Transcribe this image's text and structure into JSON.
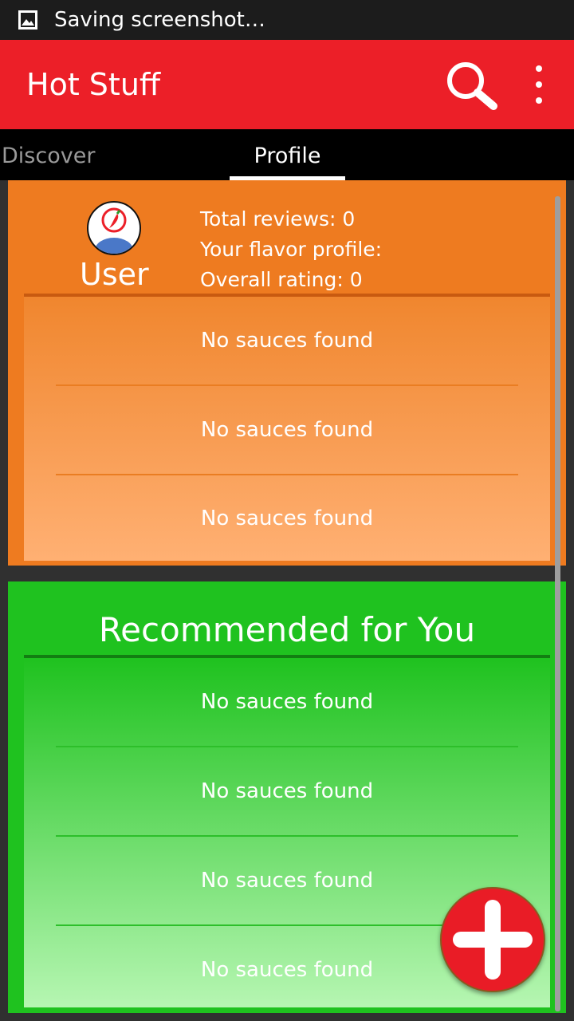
{
  "status_bar": {
    "text": "Saving screenshot…",
    "icon": "image-icon"
  },
  "app_bar": {
    "title": "Hot Stuff",
    "search_icon": "search-icon",
    "menu_icon": "more-vert-icon",
    "color": "#ec1f28"
  },
  "tabs": [
    {
      "label": "Discover",
      "selected": false
    },
    {
      "label": "Profile",
      "selected": true
    }
  ],
  "profile": {
    "avatar_icon": "chili-user-avatar-icon",
    "name": "User",
    "total_reviews": "Total reviews: 0",
    "flavor_profile": "Your flavor profile:",
    "overall_rating": "Overall rating: 0",
    "list": [
      "No sauces found",
      "No sauces found",
      "No sauces found"
    ],
    "color": "#ee7b20"
  },
  "recommended": {
    "title": "Recommended for You",
    "list": [
      "No sauces found",
      "No sauces found",
      "No sauces found",
      "No sauces found"
    ],
    "color": "#1fc21f"
  },
  "fab": {
    "icon": "add-icon",
    "color": "#e91c26"
  }
}
